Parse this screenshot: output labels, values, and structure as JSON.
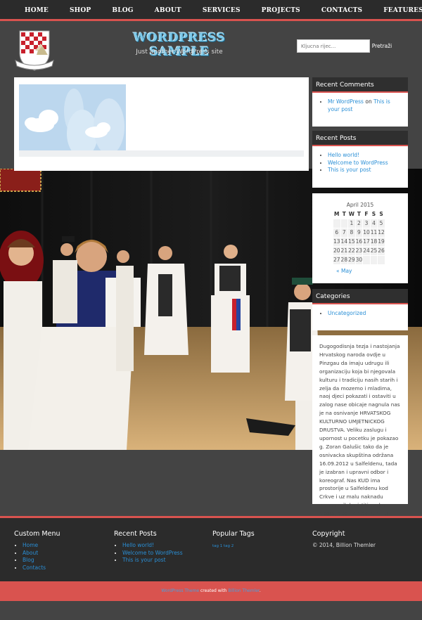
{
  "nav": {
    "items": [
      "HOME",
      "SHOP",
      "BLOG",
      "ABOUT",
      "SERVICES",
      "PROJECTS",
      "CONTACTS",
      "FEATURES"
    ]
  },
  "header": {
    "title": "WORDPRESS SAMPLE",
    "tagline": "Just another WordPress site",
    "search_placeholder": "Kljucna rijec...",
    "search_button": "Pretraži"
  },
  "sidebar": {
    "recent_comments": {
      "title": "Recent Comments",
      "author": "Mr WordPress",
      "on": " on ",
      "post": "This is your post"
    },
    "recent_posts": {
      "title": "Recent Posts",
      "items": [
        "Hello world!",
        "Welcome to WordPress",
        "This is your post"
      ]
    },
    "calendar": {
      "month": "April 2015",
      "days": [
        "M",
        "T",
        "W",
        "T",
        "F",
        "S",
        "S"
      ],
      "weeks": [
        [
          "",
          "",
          "1",
          "2",
          "3",
          "4",
          "5"
        ],
        [
          "6",
          "7",
          "8",
          "9",
          "10",
          "11",
          "12"
        ],
        [
          "13",
          "14",
          "15",
          "16",
          "17",
          "18",
          "19"
        ],
        [
          "20",
          "21",
          "22",
          "23",
          "24",
          "25",
          "26"
        ],
        [
          "27",
          "28",
          "29",
          "30",
          "",
          "",
          ""
        ]
      ],
      "prev": "« May"
    },
    "categories": {
      "title": "Categories",
      "items": [
        "Uncategorized"
      ]
    },
    "text": "Dugogodisnja tezja i nastojanja Hrvatskog naroda ovdje u Pinzgau da imaju udrugu ili organizaciju koja bi njegovala kulturu i tradiciju nasih starih i zelja da mozemo i mladima, naoj djeci pokazati i ostaviti u zalog nase obicaje nagnula nas je na osnivanje HRVATSKOG KULTURNO UMJETNICKOG DRUSTVA. Veliku zaslugu i upornost u pocetku je pokazao g. Zoran Galušic tako da je osnivacka skupština održana 16.09.2012 u Salfeldenu, tada je izabran i upravni odbor i koreograf. Nas KUD ima prostorije u Salfeldenu kod Crkve i uz malu naknadu mozemo ih koristiti svake Nedjelje od 14h do 22h. Tu održavamo redovite probe i nudimo Biffe koji prireduju nase vrijedne clanice."
  },
  "footer": {
    "custom_menu": {
      "title": "Custom Menu",
      "items": [
        "Home",
        "About",
        "Blog",
        "Contacts"
      ]
    },
    "recent_posts": {
      "title": "Recent Posts",
      "items": [
        "Hello world!",
        "Welcome to WordPress",
        "This is your post"
      ]
    },
    "popular_tags": {
      "title": "Popular Tags",
      "tags": "tag 1  tag 2"
    },
    "copyright": {
      "title": "Copyright",
      "text": "© 2014, Billion Themler"
    },
    "credit": {
      "theme_link": "WordPress Theme",
      "middle": " created with ",
      "tool_link": "Billion Themler",
      "end": "."
    }
  },
  "colors": {
    "accent": "#d9534f",
    "dark": "#2b2b2b",
    "link": "#2a8fd6",
    "title": "#7ec9e9"
  }
}
